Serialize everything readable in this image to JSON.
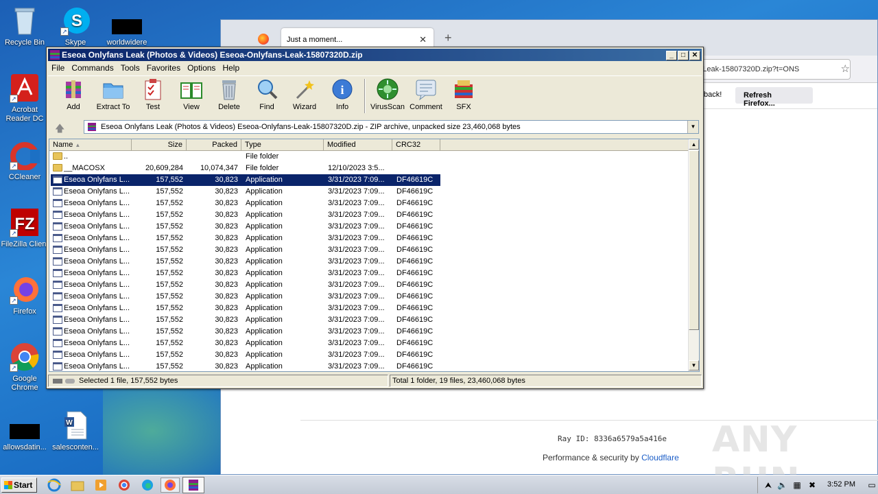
{
  "desktop": {
    "icons": [
      {
        "name": "recycle-bin",
        "label": "Recycle Bin"
      },
      {
        "name": "skype",
        "label": "Skype"
      },
      {
        "name": "worldwidere",
        "label": "worldwidere"
      },
      {
        "name": "acrobat",
        "label": "Acrobat Reader DC"
      },
      {
        "name": "ccleaner",
        "label": "CCleaner"
      },
      {
        "name": "filezilla",
        "label": "FileZilla Client"
      },
      {
        "name": "firefox",
        "label": "Firefox"
      },
      {
        "name": "chrome",
        "label": "Google Chrome"
      },
      {
        "name": "allowsdating",
        "label": "allowsdatin..."
      },
      {
        "name": "salescontent",
        "label": "salesconten..."
      }
    ],
    "build": "Build 7601"
  },
  "browser": {
    "tab_title": "Just a moment...",
    "url": "ns-Leak-15807320D.zip?t=ONS",
    "notice_text": "back!",
    "refresh_label": "Refresh Firefox...",
    "ray_id": "Ray ID: 8336a6579a5a416e",
    "perf_text": "Performance & security by ",
    "perf_link": "Cloudflare",
    "watermark": "ANY RUN"
  },
  "winrar": {
    "title": "Eseoa Onlyfans Leak (Photos & Videos) Eseoa-Onlyfans-Leak-15807320D.zip",
    "menu": [
      "File",
      "Commands",
      "Tools",
      "Favorites",
      "Options",
      "Help"
    ],
    "toolbar": [
      "Add",
      "Extract To",
      "Test",
      "View",
      "Delete",
      "Find",
      "Wizard",
      "Info",
      "VirusScan",
      "Comment",
      "SFX"
    ],
    "address": "Eseoa Onlyfans Leak (Photos & Videos) Eseoa-Onlyfans-Leak-15807320D.zip - ZIP archive, unpacked size 23,460,068 bytes",
    "columns": [
      "Name",
      "Size",
      "Packed",
      "Type",
      "Modified",
      "CRC32"
    ],
    "rows": [
      {
        "name": "..",
        "size": "",
        "packed": "",
        "type": "File folder",
        "modified": "",
        "crc": "",
        "kind": "folder"
      },
      {
        "name": "__MACOSX",
        "size": "20,609,284",
        "packed": "10,074,347",
        "type": "File folder",
        "modified": "12/10/2023 3:5...",
        "crc": "",
        "kind": "folder"
      },
      {
        "name": "Eseoa Onlyfans L...",
        "size": "157,552",
        "packed": "30,823",
        "type": "Application",
        "modified": "3/31/2023 7:09...",
        "crc": "DF46619C",
        "kind": "app"
      },
      {
        "name": "Eseoa Onlyfans L...",
        "size": "157,552",
        "packed": "30,823",
        "type": "Application",
        "modified": "3/31/2023 7:09...",
        "crc": "DF46619C",
        "kind": "app"
      },
      {
        "name": "Eseoa Onlyfans L...",
        "size": "157,552",
        "packed": "30,823",
        "type": "Application",
        "modified": "3/31/2023 7:09...",
        "crc": "DF46619C",
        "kind": "app"
      },
      {
        "name": "Eseoa Onlyfans L...",
        "size": "157,552",
        "packed": "30,823",
        "type": "Application",
        "modified": "3/31/2023 7:09...",
        "crc": "DF46619C",
        "kind": "app"
      },
      {
        "name": "Eseoa Onlyfans L...",
        "size": "157,552",
        "packed": "30,823",
        "type": "Application",
        "modified": "3/31/2023 7:09...",
        "crc": "DF46619C",
        "kind": "app"
      },
      {
        "name": "Eseoa Onlyfans L...",
        "size": "157,552",
        "packed": "30,823",
        "type": "Application",
        "modified": "3/31/2023 7:09...",
        "crc": "DF46619C",
        "kind": "app"
      },
      {
        "name": "Eseoa Onlyfans L...",
        "size": "157,552",
        "packed": "30,823",
        "type": "Application",
        "modified": "3/31/2023 7:09...",
        "crc": "DF46619C",
        "kind": "app"
      },
      {
        "name": "Eseoa Onlyfans L...",
        "size": "157,552",
        "packed": "30,823",
        "type": "Application",
        "modified": "3/31/2023 7:09...",
        "crc": "DF46619C",
        "kind": "app"
      },
      {
        "name": "Eseoa Onlyfans L...",
        "size": "157,552",
        "packed": "30,823",
        "type": "Application",
        "modified": "3/31/2023 7:09...",
        "crc": "DF46619C",
        "kind": "app"
      },
      {
        "name": "Eseoa Onlyfans L...",
        "size": "157,552",
        "packed": "30,823",
        "type": "Application",
        "modified": "3/31/2023 7:09...",
        "crc": "DF46619C",
        "kind": "app"
      },
      {
        "name": "Eseoa Onlyfans L...",
        "size": "157,552",
        "packed": "30,823",
        "type": "Application",
        "modified": "3/31/2023 7:09...",
        "crc": "DF46619C",
        "kind": "app"
      },
      {
        "name": "Eseoa Onlyfans L...",
        "size": "157,552",
        "packed": "30,823",
        "type": "Application",
        "modified": "3/31/2023 7:09...",
        "crc": "DF46619C",
        "kind": "app"
      },
      {
        "name": "Eseoa Onlyfans L...",
        "size": "157,552",
        "packed": "30,823",
        "type": "Application",
        "modified": "3/31/2023 7:09...",
        "crc": "DF46619C",
        "kind": "app"
      },
      {
        "name": "Eseoa Onlyfans L...",
        "size": "157,552",
        "packed": "30,823",
        "type": "Application",
        "modified": "3/31/2023 7:09...",
        "crc": "DF46619C",
        "kind": "app"
      },
      {
        "name": "Eseoa Onlyfans L...",
        "size": "157,552",
        "packed": "30,823",
        "type": "Application",
        "modified": "3/31/2023 7:09...",
        "crc": "DF46619C",
        "kind": "app"
      },
      {
        "name": "Eseoa Onlyfans L...",
        "size": "157,552",
        "packed": "30,823",
        "type": "Application",
        "modified": "3/31/2023 7:09...",
        "crc": "DF46619C",
        "kind": "app"
      },
      {
        "name": "Eseoa Onlyfans L...",
        "size": "157,552",
        "packed": "30,823",
        "type": "Application",
        "modified": "3/31/2023 7:09...",
        "crc": "DF46619C",
        "kind": "app"
      },
      {
        "name": "Eseoa Onlyfans L...",
        "size": "157,552",
        "packed": "30,823",
        "type": "Application",
        "modified": "3/31/2023 7:09...",
        "crc": "DF46619C",
        "kind": "app"
      }
    ],
    "selected_row": 2,
    "status_left": "Selected 1 file, 157,552 bytes",
    "status_right": "Total 1 folder, 19 files, 23,460,068 bytes"
  },
  "taskbar": {
    "start_label": "Start",
    "clock": "3:52 PM"
  }
}
